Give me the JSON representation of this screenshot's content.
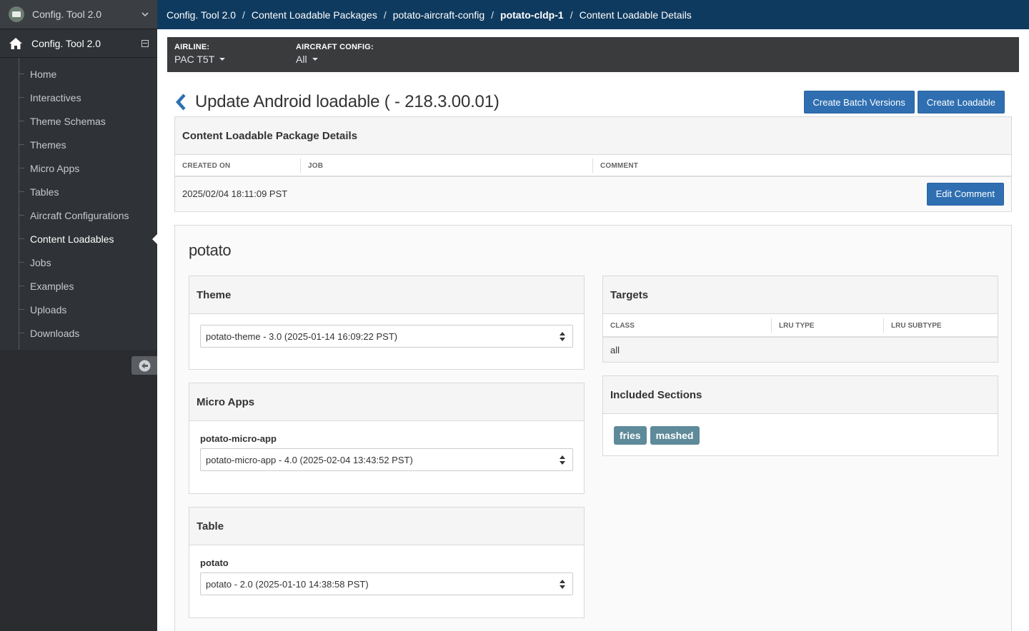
{
  "app": {
    "switcher_title": "Config. Tool 2.0",
    "sidebar_title": "Config. Tool 2.0"
  },
  "sidebar": {
    "items": [
      {
        "label": "Home"
      },
      {
        "label": "Interactives"
      },
      {
        "label": "Theme Schemas"
      },
      {
        "label": "Themes"
      },
      {
        "label": "Micro Apps"
      },
      {
        "label": "Tables"
      },
      {
        "label": "Aircraft Configurations"
      },
      {
        "label": "Content Loadables",
        "active": true
      },
      {
        "label": "Jobs"
      },
      {
        "label": "Examples"
      },
      {
        "label": "Uploads"
      },
      {
        "label": "Downloads"
      }
    ]
  },
  "breadcrumb": [
    "Config. Tool 2.0",
    "Content Loadable Packages",
    "potato-aircraft-config",
    "potato-cldp-1",
    "Content Loadable Details"
  ],
  "filters": {
    "airline_label": "AIRLINE:",
    "airline_value": "PAC T5T",
    "aircraft_label": "AIRCRAFT CONFIG:",
    "aircraft_value": "All"
  },
  "header": {
    "title": "Update Android loadable ( - 218.3.00.01)",
    "create_batch_label": "Create Batch Versions",
    "create_loadable_label": "Create Loadable"
  },
  "details": {
    "title": "Content Loadable Package Details",
    "columns": [
      "CREATED ON",
      "JOB",
      "COMMENT"
    ],
    "created_on": "2025/02/04 18:11:09 PST",
    "job": "",
    "comment": "",
    "edit_comment_label": "Edit Comment"
  },
  "main": {
    "title": "potato",
    "theme": {
      "title": "Theme",
      "selected": "potato-theme - 3.0 (2025-01-14 16:09:22 PST)"
    },
    "micro_apps": {
      "title": "Micro Apps",
      "field_label": "potato-micro-app",
      "selected": "potato-micro-app - 4.0 (2025-02-04 13:43:52 PST)"
    },
    "table": {
      "title": "Table",
      "field_label": "potato",
      "selected": "potato - 2.0 (2025-01-10 14:38:58 PST)"
    },
    "targets": {
      "title": "Targets",
      "columns": [
        "CLASS",
        "LRU TYPE",
        "LRU SUBTYPE"
      ],
      "rows": [
        [
          "all",
          "",
          ""
        ]
      ]
    },
    "included_sections": {
      "title": "Included Sections",
      "tags": [
        "fries",
        "mashed"
      ]
    }
  },
  "colors": {
    "topbar": "#0f3a5f",
    "sidebar": "#2a2c30",
    "primary_button": "#2f6fb1",
    "tag": "#5e8a9a",
    "filterbar": "#3a3b3d"
  },
  "icons": [
    "app-logo-icon",
    "chevron-down-icon",
    "home-icon",
    "collapse-icon",
    "back-chevron-icon",
    "arrow-left-circle-icon",
    "select-arrows-icon",
    "caret-down-icon"
  ]
}
